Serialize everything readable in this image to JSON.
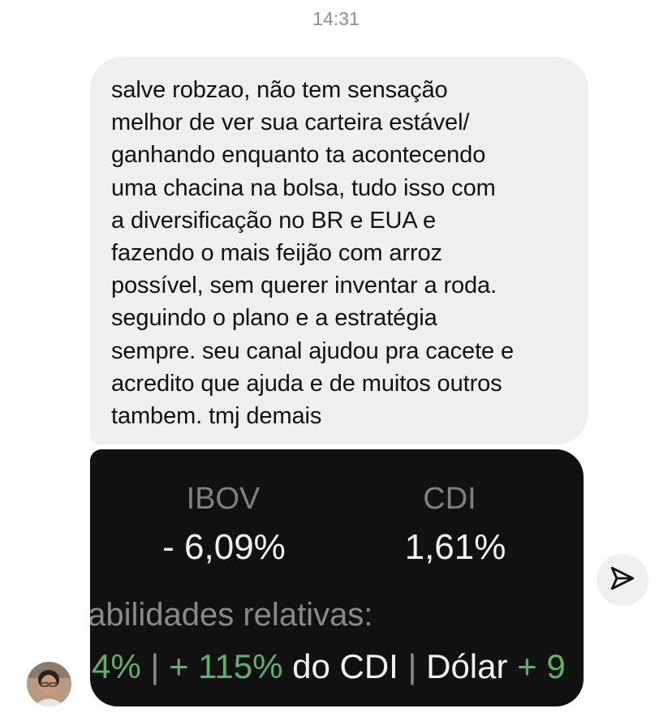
{
  "thread": {
    "timestamp": "14:31"
  },
  "message": {
    "text": "salve robzao, não tem sensação\nmelhor de ver sua carteira estável/\nganhando enquanto ta acontecendo\numa chacina na bolsa, tudo isso com\na diversificação no BR e EUA e\nfazendo o mais feijão com arroz\npossível, sem querer inventar a roda.\nseguindo o plano e a estratégia\nsempre. seu canal ajudou pra cacete e\nacredito que ajuda e de muitos outros\ntambem. tmj demais"
  },
  "image": {
    "ibov_label": "IBOV",
    "ibov_value": "- 6,09%",
    "cdi_label": "CDI",
    "cdi_value": "1,61%",
    "relative_line": "tabilidades relativas:",
    "bottom": {
      "part1": "4%",
      "sep1": " | ",
      "part2": "+ 115%",
      "part3": " do CDI ",
      "sep2": "| ",
      "part4": "Dólar ",
      "part5": "+ 9"
    }
  },
  "icons": {
    "send": "paper-plane-icon",
    "avatar": "avatar"
  },
  "colors": {
    "bubble_bg": "#efefef",
    "image_bg": "#111111",
    "positive": "#5fb06a"
  }
}
